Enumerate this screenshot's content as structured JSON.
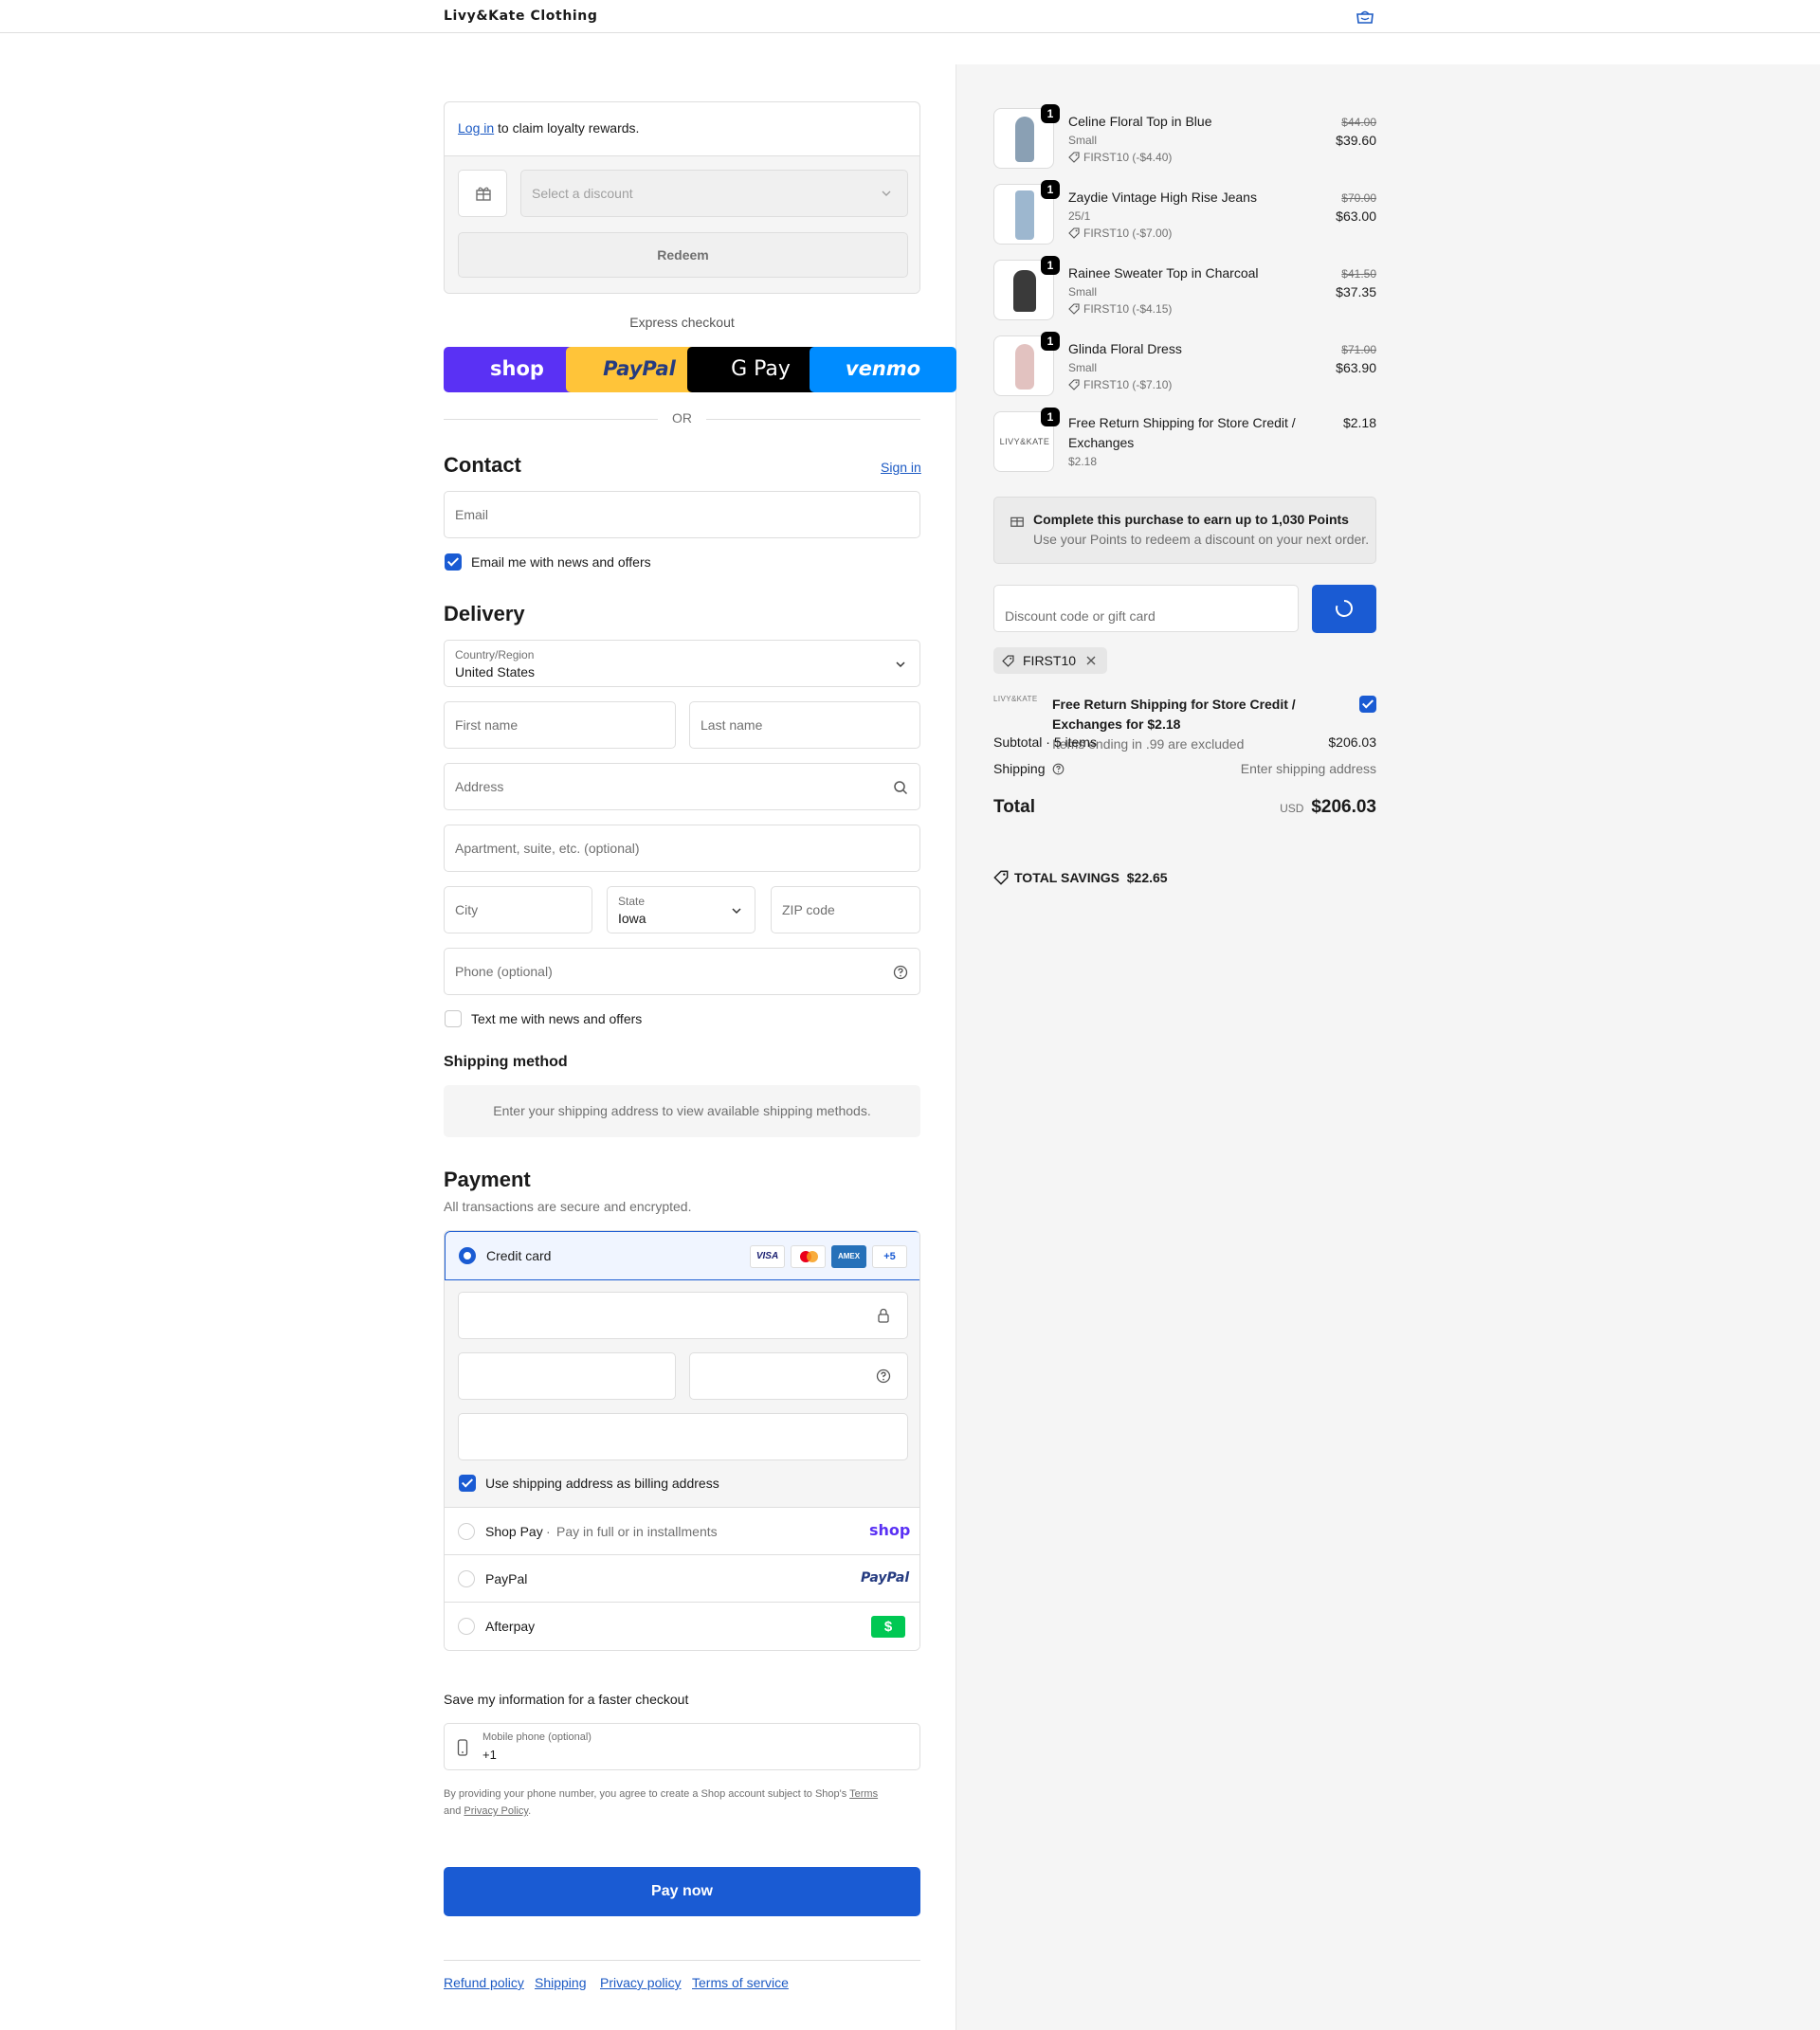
{
  "header": {
    "brand": "Livy&Kate Clothing"
  },
  "loyalty": {
    "login_link": "Log in",
    "login_text": "to claim loyalty rewards.",
    "discount_placeholder": "Select a discount",
    "redeem_label": "Redeem"
  },
  "express": {
    "title": "Express checkout",
    "buttons": [
      "shop",
      "PayPal",
      "G Pay",
      "venmo"
    ],
    "divider": "OR"
  },
  "contact": {
    "title": "Contact",
    "sign_in": "Sign in",
    "email_placeholder": "Email",
    "news_label": "Email me with news and offers",
    "news_checked": true
  },
  "delivery": {
    "title": "Delivery",
    "country_label": "Country/Region",
    "country_value": "United States",
    "first_name": "First name",
    "last_name": "Last name",
    "address": "Address",
    "apartment": "Apartment, suite, etc. (optional)",
    "city": "City",
    "state_label": "State",
    "state_value": "Iowa",
    "zip": "ZIP code",
    "phone": "Phone (optional)",
    "text_label": "Text me with news and offers",
    "text_checked": false
  },
  "shipping_method": {
    "title": "Shipping method",
    "message": "Enter your shipping address to view available shipping methods."
  },
  "payment": {
    "title": "Payment",
    "subtitle": "All transactions are secure and encrypted.",
    "credit_card_label": "Credit card",
    "card_brands": [
      "VISA",
      "Mastercard",
      "AMEX",
      "+5"
    ],
    "billing_label": "Use shipping address as billing address",
    "billing_checked": true,
    "options": [
      {
        "label": "Shop Pay",
        "sub": "Pay in full or in installments",
        "logo": "shop"
      },
      {
        "label": "PayPal",
        "sub": "",
        "logo": "PayPal"
      },
      {
        "label": "Afterpay",
        "sub": "",
        "logo": "$"
      }
    ]
  },
  "save_info": {
    "title": "Save my information for a faster checkout",
    "phone_label": "Mobile phone (optional)",
    "phone_value": "+1",
    "consent_prefix": "By providing your phone number, you agree to create a Shop account subject to Shop's",
    "terms": "Terms",
    "and": "and",
    "privacy": "Privacy Policy",
    "period": "."
  },
  "pay_now": "Pay now",
  "footer_links": [
    "Refund policy",
    "Shipping",
    "Privacy policy",
    "Terms of service"
  ],
  "summary": {
    "items": [
      {
        "qty": "1",
        "name": "Celine Floral Top in Blue",
        "variant": "Small",
        "discount": "FIRST10 (-$4.40)",
        "old_price": "$44.00",
        "price": "$39.60",
        "img_color": "#8aa0b4"
      },
      {
        "qty": "1",
        "name": "Zaydie Vintage High Rise Jeans",
        "variant": "25/1",
        "discount": "FIRST10 (-$7.00)",
        "old_price": "$70.00",
        "price": "$63.00",
        "img_color": "#9db7cf"
      },
      {
        "qty": "1",
        "name": "Rainee Sweater Top in Charcoal",
        "variant": "Small",
        "discount": "FIRST10 (-$4.15)",
        "old_price": "$41.50",
        "price": "$37.35",
        "img_color": "#3a3a3a"
      },
      {
        "qty": "1",
        "name": "Glinda Floral Dress",
        "variant": "Small",
        "discount": "FIRST10 (-$7.10)",
        "old_price": "$71.00",
        "price": "$63.90",
        "img_color": "#e2c2c0"
      },
      {
        "qty": "1",
        "name_line1": "Free Return Shipping for Store Credit /",
        "name_line2": "Exchanges",
        "variant": "$2.18",
        "price": "$2.18",
        "thumb_text": "LIVY&KATE"
      }
    ],
    "points_title": "Complete this purchase to earn up to 1,030 Points",
    "points_sub": "Use your Points to redeem a discount on your next order.",
    "discount_placeholder": "Discount code or gift card",
    "applied_code": "FIRST10",
    "upsell_logo": "LIVY&KATE",
    "upsell_line1": "Free Return Shipping for Store Credit /",
    "upsell_line2": "Exchanges for $2.18",
    "upsell_note": "Items ending in .99 are excluded",
    "upsell_checked": true,
    "subtotal_label": "Subtotal · 5 items",
    "subtotal_value": "$206.03",
    "shipping_label": "Shipping",
    "shipping_value": "Enter shipping address",
    "total_label": "Total",
    "currency": "USD",
    "total_value": "$206.03",
    "savings_label": "TOTAL SAVINGS",
    "savings_value": "$22.65"
  },
  "colors": {
    "accent": "#1a5bd3",
    "shop_purple": "#5a31f4",
    "paypal_yellow": "#ffc439",
    "venmo_blue": "#008cff",
    "afterpay_green": "#00c853"
  }
}
